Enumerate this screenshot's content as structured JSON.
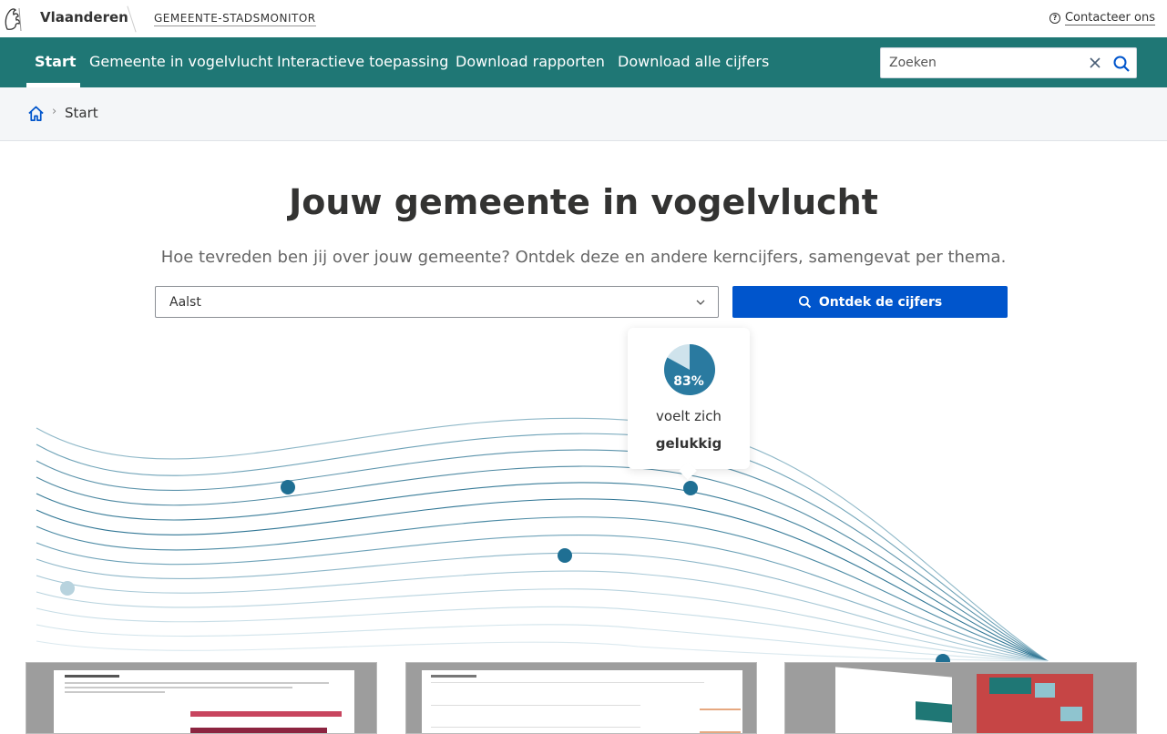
{
  "topbar": {
    "brand": "Vlaanderen",
    "site_name": "GEMEENTE-STADSMONITOR",
    "contact_label": "Contacteer ons"
  },
  "nav": {
    "items": [
      {
        "label": "Start",
        "active": true
      },
      {
        "label": "Gemeente in vogelvlucht"
      },
      {
        "label": "Interactieve toepassing"
      },
      {
        "label": "Download rapporten"
      },
      {
        "label": "Download alle cijfers"
      }
    ],
    "search_placeholder": "Zoeken"
  },
  "breadcrumb": {
    "current": "Start"
  },
  "hero": {
    "title": "Jouw gemeente in vogelvlucht",
    "subtitle": "Hoe tevreden ben jij over jouw gemeente? Ontdek deze en andere kerncijfers, samengevat per thema.",
    "selected_municipality": "Aalst",
    "cta_label": "Ontdek de cijfers"
  },
  "stat_card": {
    "percentage": "83%",
    "value": 0.83,
    "line1": "voelt zich",
    "line2": "gelukkig"
  },
  "colors": {
    "nav_bg": "#1f7775",
    "cta_bg": "#0055cc",
    "accent_dot": "#1f6f93",
    "pie_main": "#2a7aa0",
    "pie_rest": "#cfe3ec"
  },
  "icons": [
    "flanders-lion-logo",
    "help-icon",
    "clear-icon",
    "search-icon",
    "home-icon",
    "chevron-down-icon"
  ]
}
